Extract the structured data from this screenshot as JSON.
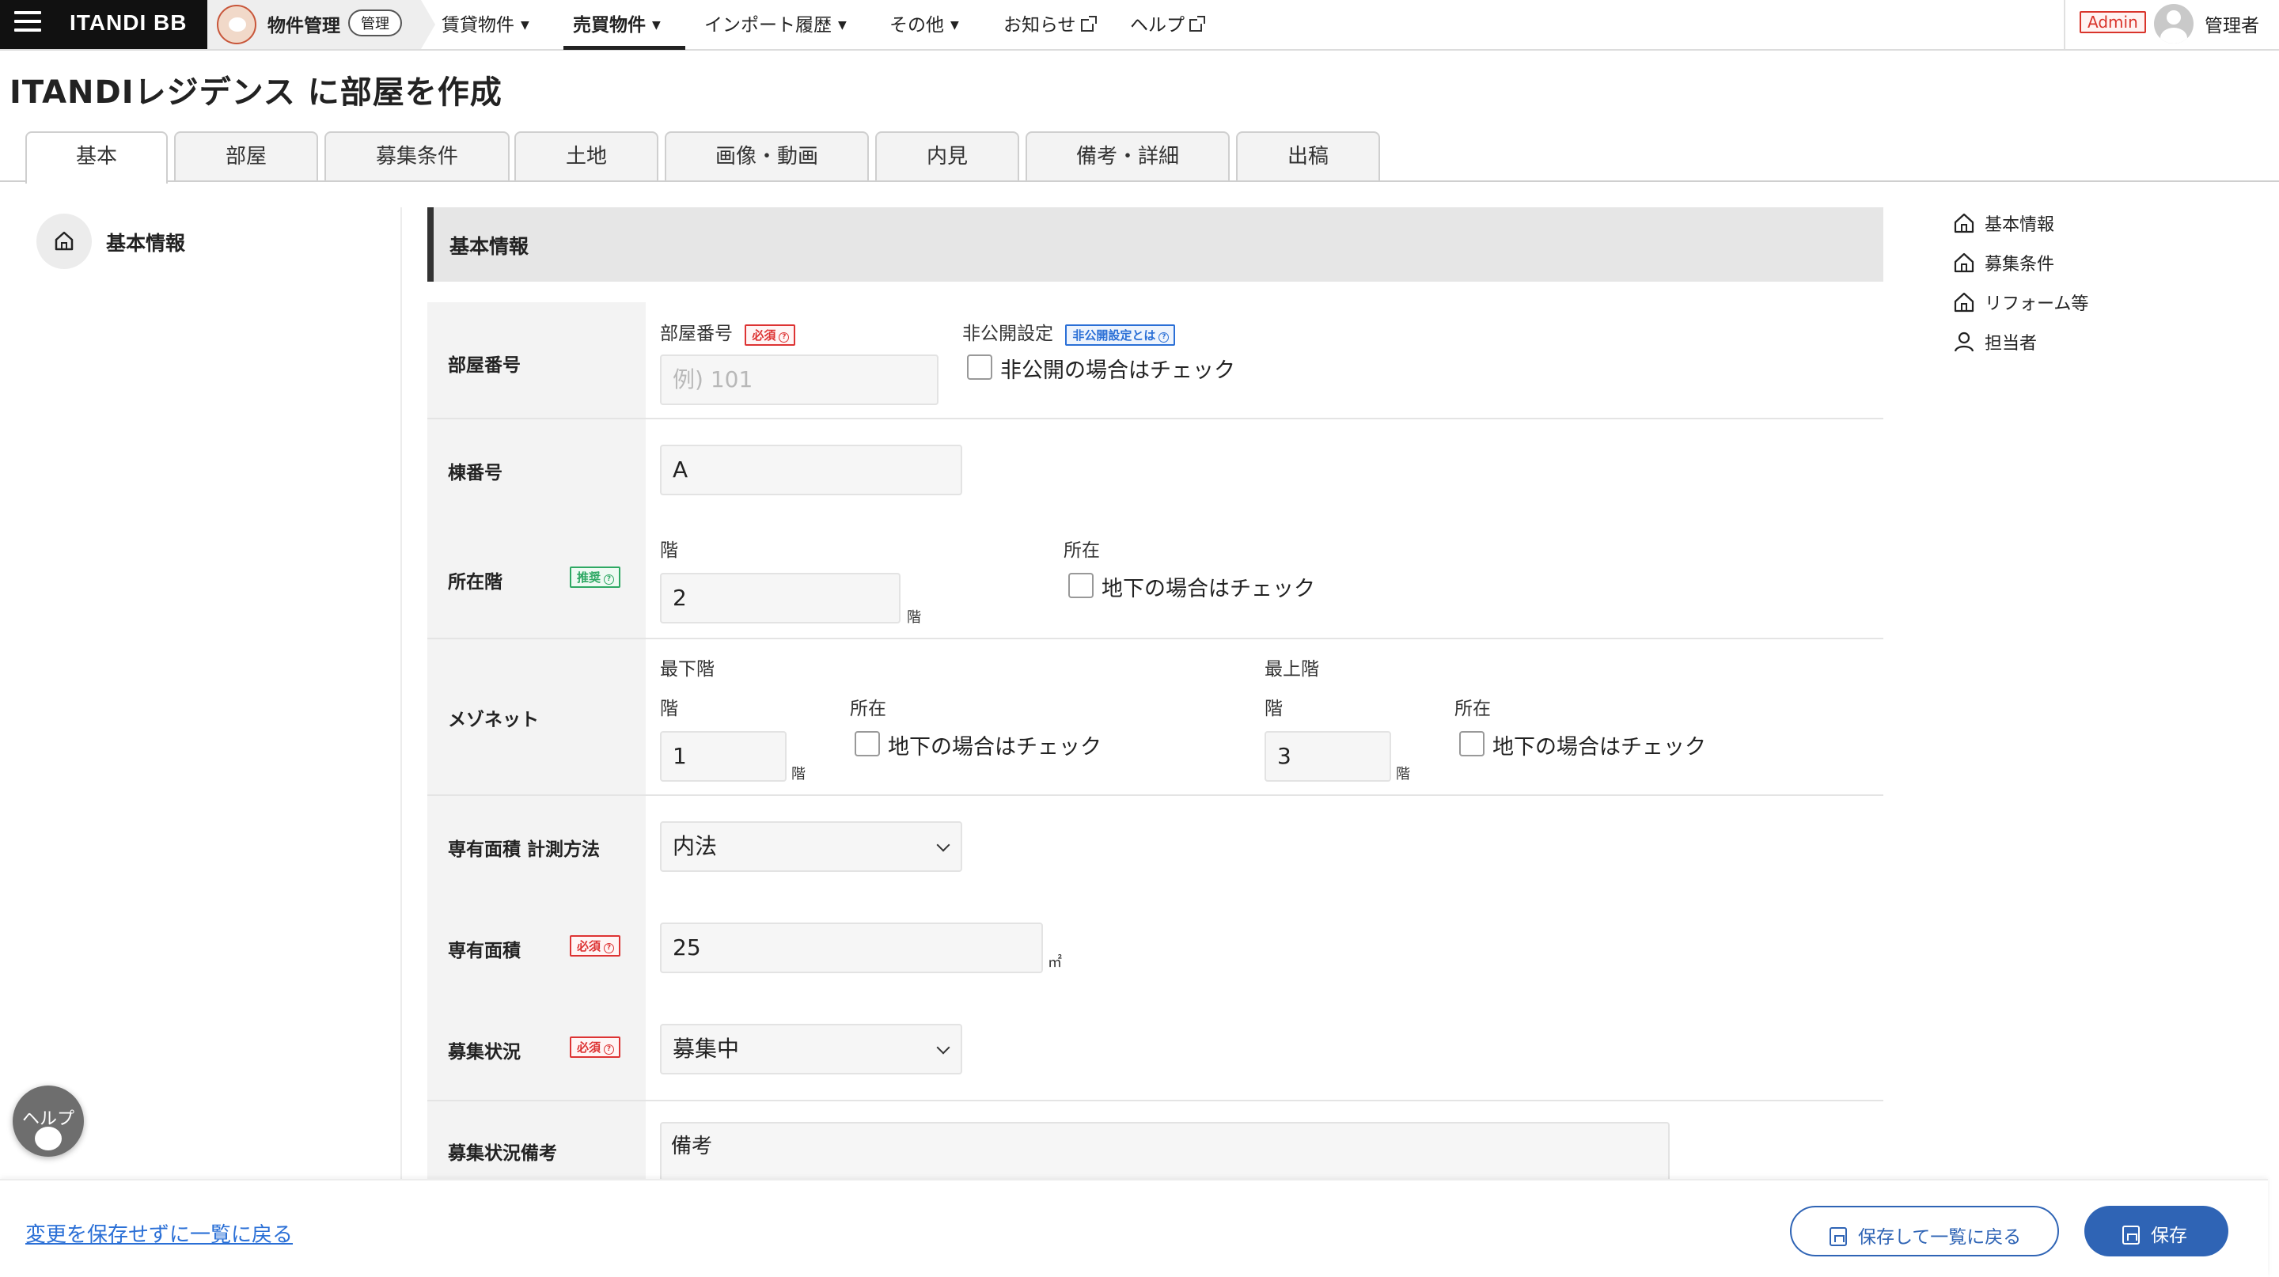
{
  "app": {
    "brand": "ITANDI BB",
    "module_label": "物件管理",
    "module_badge": "管理"
  },
  "nav": {
    "items": [
      {
        "label": "賃貸物件"
      },
      {
        "label": "売買物件"
      },
      {
        "label": "インポート履歴"
      },
      {
        "label": "その他"
      },
      {
        "label": "お知らせ"
      },
      {
        "label": "ヘルプ"
      }
    ],
    "active": "売買物件"
  },
  "user": {
    "role_badge": "Admin",
    "name": "管理者"
  },
  "page": {
    "title": "ITANDIレジデンス に部屋を作成"
  },
  "tabs": [
    {
      "label": "基本"
    },
    {
      "label": "部屋"
    },
    {
      "label": "募集条件"
    },
    {
      "label": "土地"
    },
    {
      "label": "画像・動画"
    },
    {
      "label": "内見"
    },
    {
      "label": "備考・詳細"
    },
    {
      "label": "出稿"
    }
  ],
  "left_nav": {
    "label": "基本情報"
  },
  "section": {
    "title": "基本情報"
  },
  "badges": {
    "required": "必須",
    "recommended": "推奨",
    "private_help": "非公開設定とは"
  },
  "form": {
    "room_number": {
      "row_label": "部屋番号",
      "field_label": "部屋番号",
      "placeholder": "例) 101",
      "value": ""
    },
    "private": {
      "label": "非公開設定",
      "checkbox_label": "非公開の場合はチェック",
      "checked": false
    },
    "building_number": {
      "row_label": "棟番号",
      "value": "A"
    },
    "floor": {
      "row_label": "所在階",
      "floor_label": "階",
      "value": "2",
      "unit": "階",
      "location_label": "所在",
      "basement_label": "地下の場合はチェック"
    },
    "maisonette": {
      "row_label": "メゾネット",
      "lowest_label": "最下階",
      "highest_label": "最上階",
      "floor_label": "階",
      "location_label": "所在",
      "lowest_value": "1",
      "highest_value": "3",
      "unit": "階",
      "basement_label": "地下の場合はチェック"
    },
    "area_method": {
      "row_label": "専有面積 計測方法",
      "value": "内法"
    },
    "area": {
      "row_label": "専有面積",
      "value": "25",
      "unit": "㎡"
    },
    "recruit_status": {
      "row_label": "募集状況",
      "value": "募集中"
    },
    "recruit_note": {
      "row_label": "募集状況備考",
      "value": "備考"
    }
  },
  "right_nav": [
    {
      "label": "基本情報",
      "icon": "home-icon"
    },
    {
      "label": "募集条件",
      "icon": "home-icon"
    },
    {
      "label": "リフォーム等",
      "icon": "home-icon"
    },
    {
      "label": "担当者",
      "icon": "person-icon"
    }
  ],
  "help_fab": {
    "label": "ヘルプ"
  },
  "footer": {
    "back_link": "変更を保存せずに一覧に戻る",
    "save_and_back": "保存して一覧に戻る",
    "save": "保存"
  },
  "colors": {
    "accent": "#2f64b5",
    "required": "#dd3333",
    "recommended": "#2ea863"
  }
}
